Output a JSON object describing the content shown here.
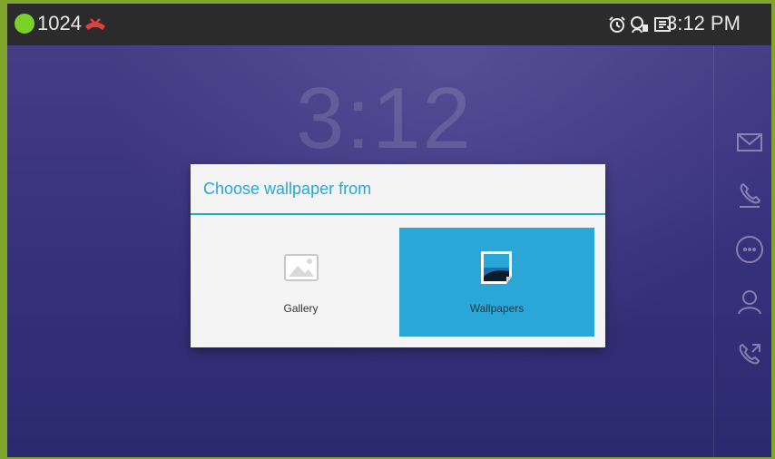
{
  "statusbar": {
    "extension": "1024",
    "time": "3:12 PM",
    "presence_color": "#7ad12a",
    "icons": [
      "alarm-icon",
      "voicemail-icon",
      "screen-icon"
    ]
  },
  "lockscreen": {
    "clock": "3:12"
  },
  "dialog": {
    "title": "Choose wallpaper from",
    "options": [
      {
        "label": "Gallery",
        "icon": "gallery-image-icon",
        "selected": false
      },
      {
        "label": "Wallpapers",
        "icon": "wallpapers-image-icon",
        "selected": true
      }
    ],
    "accent_color": "#2aa7d6"
  },
  "rail": {
    "icons": [
      "mail-icon",
      "phone-icon",
      "apps-grid-icon",
      "contacts-icon",
      "call-forward-icon"
    ]
  }
}
